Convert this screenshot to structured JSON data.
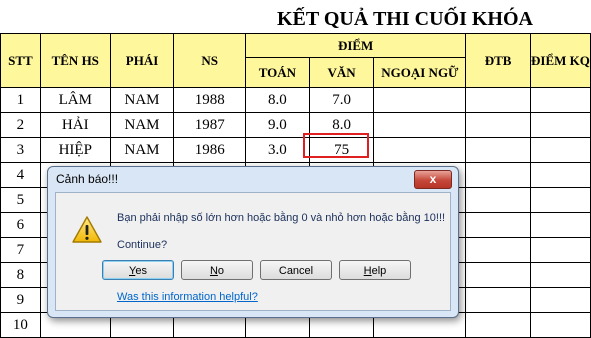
{
  "sheet": {
    "title": "KẾT QUẢ THI CUỐI KHÓA",
    "headers": {
      "stt": "STT",
      "ten_hs": "TÊN HS",
      "phai": "PHÁI",
      "ns": "NS",
      "diem": "ĐIỂM",
      "toan": "TOÁN",
      "van": "VĂN",
      "ngoai_ngu": "NGOẠI NGỮ",
      "dtb": "ĐTB",
      "diem_kq": "ĐIỂM KQ"
    },
    "rows": [
      {
        "stt": "1",
        "ten": "LÂM",
        "phai": "NAM",
        "ns": "1988",
        "toan": "8.0",
        "van": "7.0"
      },
      {
        "stt": "2",
        "ten": "HẢI",
        "phai": "NAM",
        "ns": "1987",
        "toan": "9.0",
        "van": "8.0"
      },
      {
        "stt": "3",
        "ten": "HIỆP",
        "phai": "NAM",
        "ns": "1986",
        "toan": "3.0",
        "van": "75"
      },
      {
        "stt": "4"
      },
      {
        "stt": "5"
      },
      {
        "stt": "6"
      },
      {
        "stt": "7"
      },
      {
        "stt": "8"
      },
      {
        "stt": "9"
      },
      {
        "stt": "10"
      }
    ]
  },
  "dialog": {
    "title": "Cảnh báo!!!",
    "close_glyph": "x",
    "icon": "warning-icon",
    "message": "Bạn phải nhập số lớn hơn hoặc bằng 0 và nhỏ hơn hoặc bằng 10!!!",
    "prompt": "Continue?",
    "buttons": {
      "yes": {
        "mnemonic": "Y",
        "rest": "es"
      },
      "no": {
        "mnemonic": "N",
        "rest": "o"
      },
      "cancel": "Cancel",
      "help": {
        "mnemonic": "H",
        "rest": "elp"
      }
    },
    "help_link": "Was this information helpful?"
  },
  "colors": {
    "header_fill": "#fff79c",
    "highlight_border": "#e02020",
    "dialog_frame": "#d9e6f5",
    "link": "#0066cc"
  }
}
